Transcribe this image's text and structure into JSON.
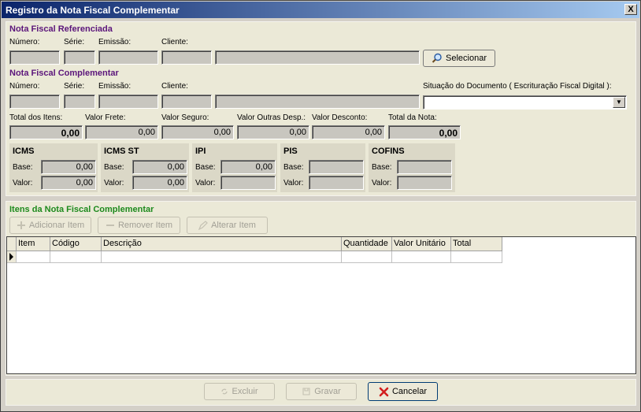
{
  "window": {
    "title": "Registro da Nota Fiscal Complementar",
    "close_glyph": "X"
  },
  "referenced": {
    "title": "Nota Fiscal Referenciada",
    "labels": {
      "numero": "Número:",
      "serie": "Série:",
      "emissao": "Emissão:",
      "cliente": "Cliente:"
    },
    "select_button": "Selecionar"
  },
  "complementary": {
    "title": "Nota Fiscal Complementar",
    "labels": {
      "numero": "Número:",
      "serie": "Série:",
      "emissao": "Emissão:",
      "cliente": "Cliente:",
      "situacao": "Situação do Documento ( Escrituração Fiscal Digital ):"
    },
    "totals_labels": {
      "itens": "Total dos Itens:",
      "frete": "Valor Frete:",
      "seguro": "Valor Seguro:",
      "outras": "Valor Outras Desp.:",
      "desconto": "Valor Desconto:",
      "nota": "Total da Nota:"
    },
    "totals_values": {
      "itens": "0,00",
      "frete": "0,00",
      "seguro": "0,00",
      "outras": "0,00",
      "desconto": "0,00",
      "nota": "0,00"
    }
  },
  "taxes": {
    "base_label": "Base:",
    "valor_label": "Valor:",
    "icms": {
      "title": "ICMS",
      "base": "0,00",
      "valor": "0,00"
    },
    "icms_st": {
      "title": "ICMS ST",
      "base": "0,00",
      "valor": "0,00"
    },
    "ipi": {
      "title": "IPI",
      "base": "0,00",
      "valor": ""
    },
    "pis": {
      "title": "PIS",
      "base": "",
      "valor": ""
    },
    "cofins": {
      "title": "COFINS",
      "base": "",
      "valor": ""
    }
  },
  "items": {
    "title": "Itens da Nota Fiscal Complementar",
    "add_button": "Adicionar Item",
    "remove_button": "Remover Item",
    "edit_button": "Alterar Item",
    "columns": [
      "Item",
      "Código",
      "Descrição",
      "Quantidade",
      "Valor Unitário",
      "Total"
    ]
  },
  "footer": {
    "delete_button": "Excluir",
    "save_button": "Gravar",
    "cancel_button": "Cancelar"
  },
  "colors": {
    "title_gradient_start": "#0a246a",
    "section_purple": "#5b157b",
    "section_green": "#1d8a1d",
    "cancel_icon": "#d21e1e"
  }
}
